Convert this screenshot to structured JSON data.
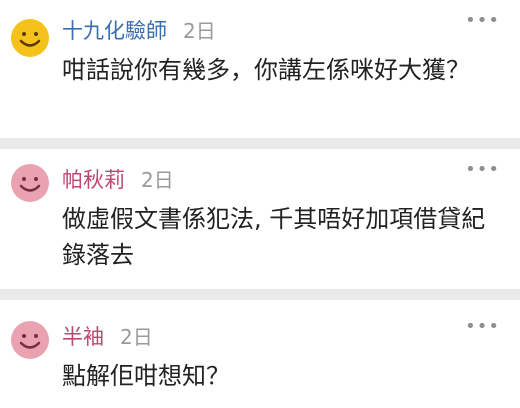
{
  "comments": [
    {
      "name": "十九化驗師",
      "time": "2日",
      "text": "咁話說你有幾多，你講左係咪好大獲？",
      "name_color": "#3a6fae",
      "avatar_color": "#f4c21a",
      "avatar_icon": "smiley-face-icon",
      "more_icon": "more-dots-icon"
    },
    {
      "name": "帕秋莉",
      "time": "2日",
      "text": "做虛假文書係犯法, 千其唔好加項借貸紀錄落去",
      "name_color": "#c0476f",
      "avatar_color": "#e9a3b0",
      "avatar_icon": "smiley-face-icon",
      "more_icon": "more-dots-icon"
    },
    {
      "name": "半袖",
      "time": "2日",
      "text": "點解佢咁想知？",
      "name_color": "#c0476f",
      "avatar_color": "#e9a3b0",
      "avatar_icon": "smiley-face-icon",
      "more_icon": "more-dots-icon"
    }
  ]
}
